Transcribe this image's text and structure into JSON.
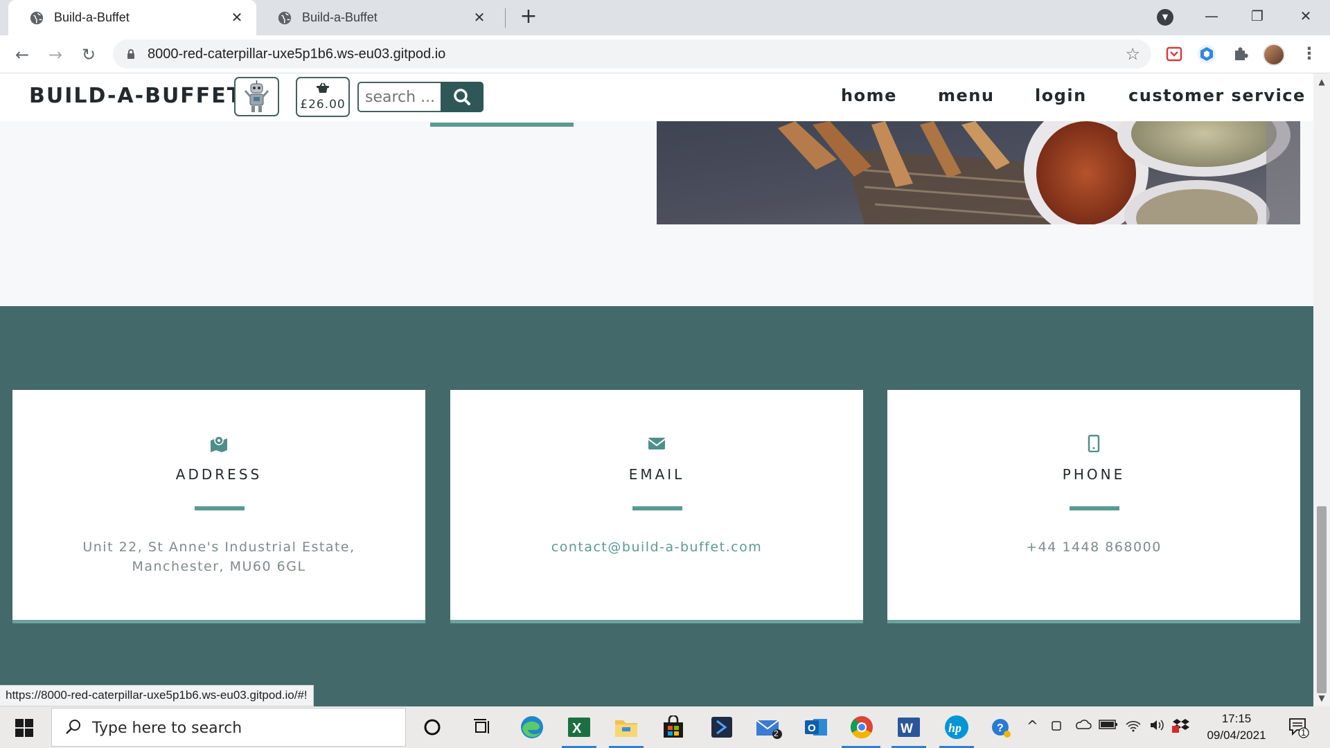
{
  "browser": {
    "tabs": [
      {
        "title": "Build-a-Buffet",
        "active": true
      },
      {
        "title": "Build-a-Buffet",
        "active": false
      }
    ],
    "url": "8000-red-caterpillar-uxe5p1b6.ws-eu03.gitpod.io",
    "status_url": "https://8000-red-caterpillar-uxe5p1b6.ws-eu03.gitpod.io/#!",
    "icons": [
      "back-icon",
      "forward-icon",
      "reload-icon",
      "lock-icon",
      "bookmark-star-icon",
      "extension-icon",
      "profile-avatar",
      "menu-icon"
    ]
  },
  "site": {
    "brand": "BUILD-A-BUFFET",
    "basket_total": "£26.00",
    "search_placeholder": "search ...",
    "nav": [
      "home",
      "menu",
      "login",
      "customer service"
    ]
  },
  "contact_cards": [
    {
      "icon": "map-marker-icon",
      "title": "ADDRESS",
      "text": "Unit 22, St Anne's Industrial Estate, Manchester, MU60 6GL",
      "link": false
    },
    {
      "icon": "envelope-icon",
      "title": "EMAIL",
      "text": "contact@build-a-buffet.com",
      "link": true
    },
    {
      "icon": "mobile-phone-icon",
      "title": "PHONE",
      "text": "+44 1448 868000",
      "link": false
    }
  ],
  "colors": {
    "footer_bg": "#44696a",
    "accent": "#5a9a94",
    "search_button": "#2f5757"
  },
  "taskbar": {
    "search_text": "Type here to search",
    "time": "17:15",
    "date": "09/04/2021",
    "mail_badge": "2",
    "notification_badge": "1"
  }
}
